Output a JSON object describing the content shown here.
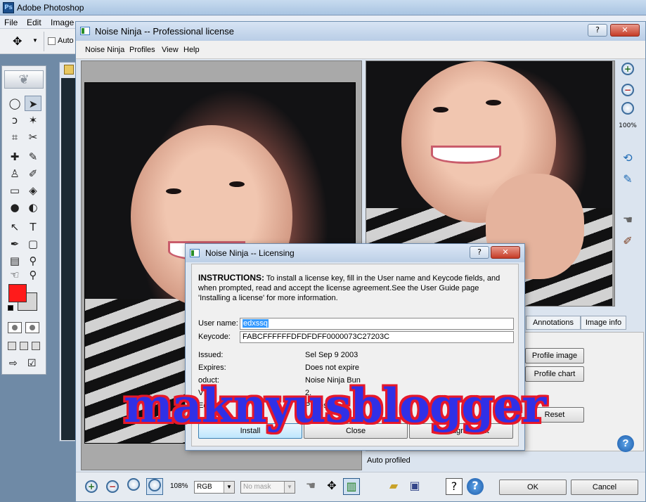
{
  "photoshop": {
    "title": "Adobe Photoshop",
    "logo_text": "Ps",
    "menu": [
      "File",
      "Edit",
      "Image"
    ],
    "options": {
      "auto_label": "Auto"
    }
  },
  "noise_ninja": {
    "title": "Noise Ninja -- Professional license",
    "menu": [
      "Noise Ninja",
      "Profiles",
      "View",
      "Help"
    ],
    "zoom_readout": "100%",
    "tabs": [
      "Annotations",
      "Image info"
    ],
    "buttons": {
      "profile_image": "Profile image",
      "profile_chart": "Profile chart",
      "reset": "Reset"
    },
    "status": "Auto profiled",
    "bottom": {
      "zoom_level": "108%",
      "color_mode": "RGB",
      "mask": "No mask",
      "ok": "OK",
      "cancel": "Cancel"
    }
  },
  "licensing": {
    "title": "Noise Ninja -- Licensing",
    "instructions_heading": "INSTRUCTIONS:",
    "instructions_line1": "To install a license key, fill in the User name and Keycode fields, and",
    "instructions_line2": "when prompted, read and accept the license agreement.See the User Guide page",
    "instructions_line3": "'Installing a license' for more information.",
    "user_name_label": "User name:",
    "user_name_value": "edxssq",
    "keycode_label": "Keycode:",
    "keycode_value": "FABCFFFFFFDFDFDFF0000073C27203C",
    "issued_label": "Issued:",
    "issued_value": "Sel Sep 9 2003",
    "expires_label": "Expires:",
    "expires_value": "Does not expire",
    "product_label": "oduct:",
    "product_value": "Noise Ninja Bun",
    "version_label": "V",
    "version_value": "2.",
    "edition_label": "Edition:",
    "edition_value": "Professional",
    "install_button": "Install",
    "close_button": "Close",
    "view_agreement_button": "View agreement"
  },
  "watermark": "maknyusblogger",
  "colors": {
    "foreground_swatch": "#ff1b1b",
    "background_swatch": "#d6d6d6",
    "selection_highlight": "#3399ff",
    "watermark_fill": "#3030e6",
    "watermark_outline": "#e6182a"
  },
  "icons": {
    "move_tool": "move-icon",
    "zoom_in": "zoom-in-icon",
    "zoom_out": "zoom-out-icon",
    "help": "help-icon"
  }
}
